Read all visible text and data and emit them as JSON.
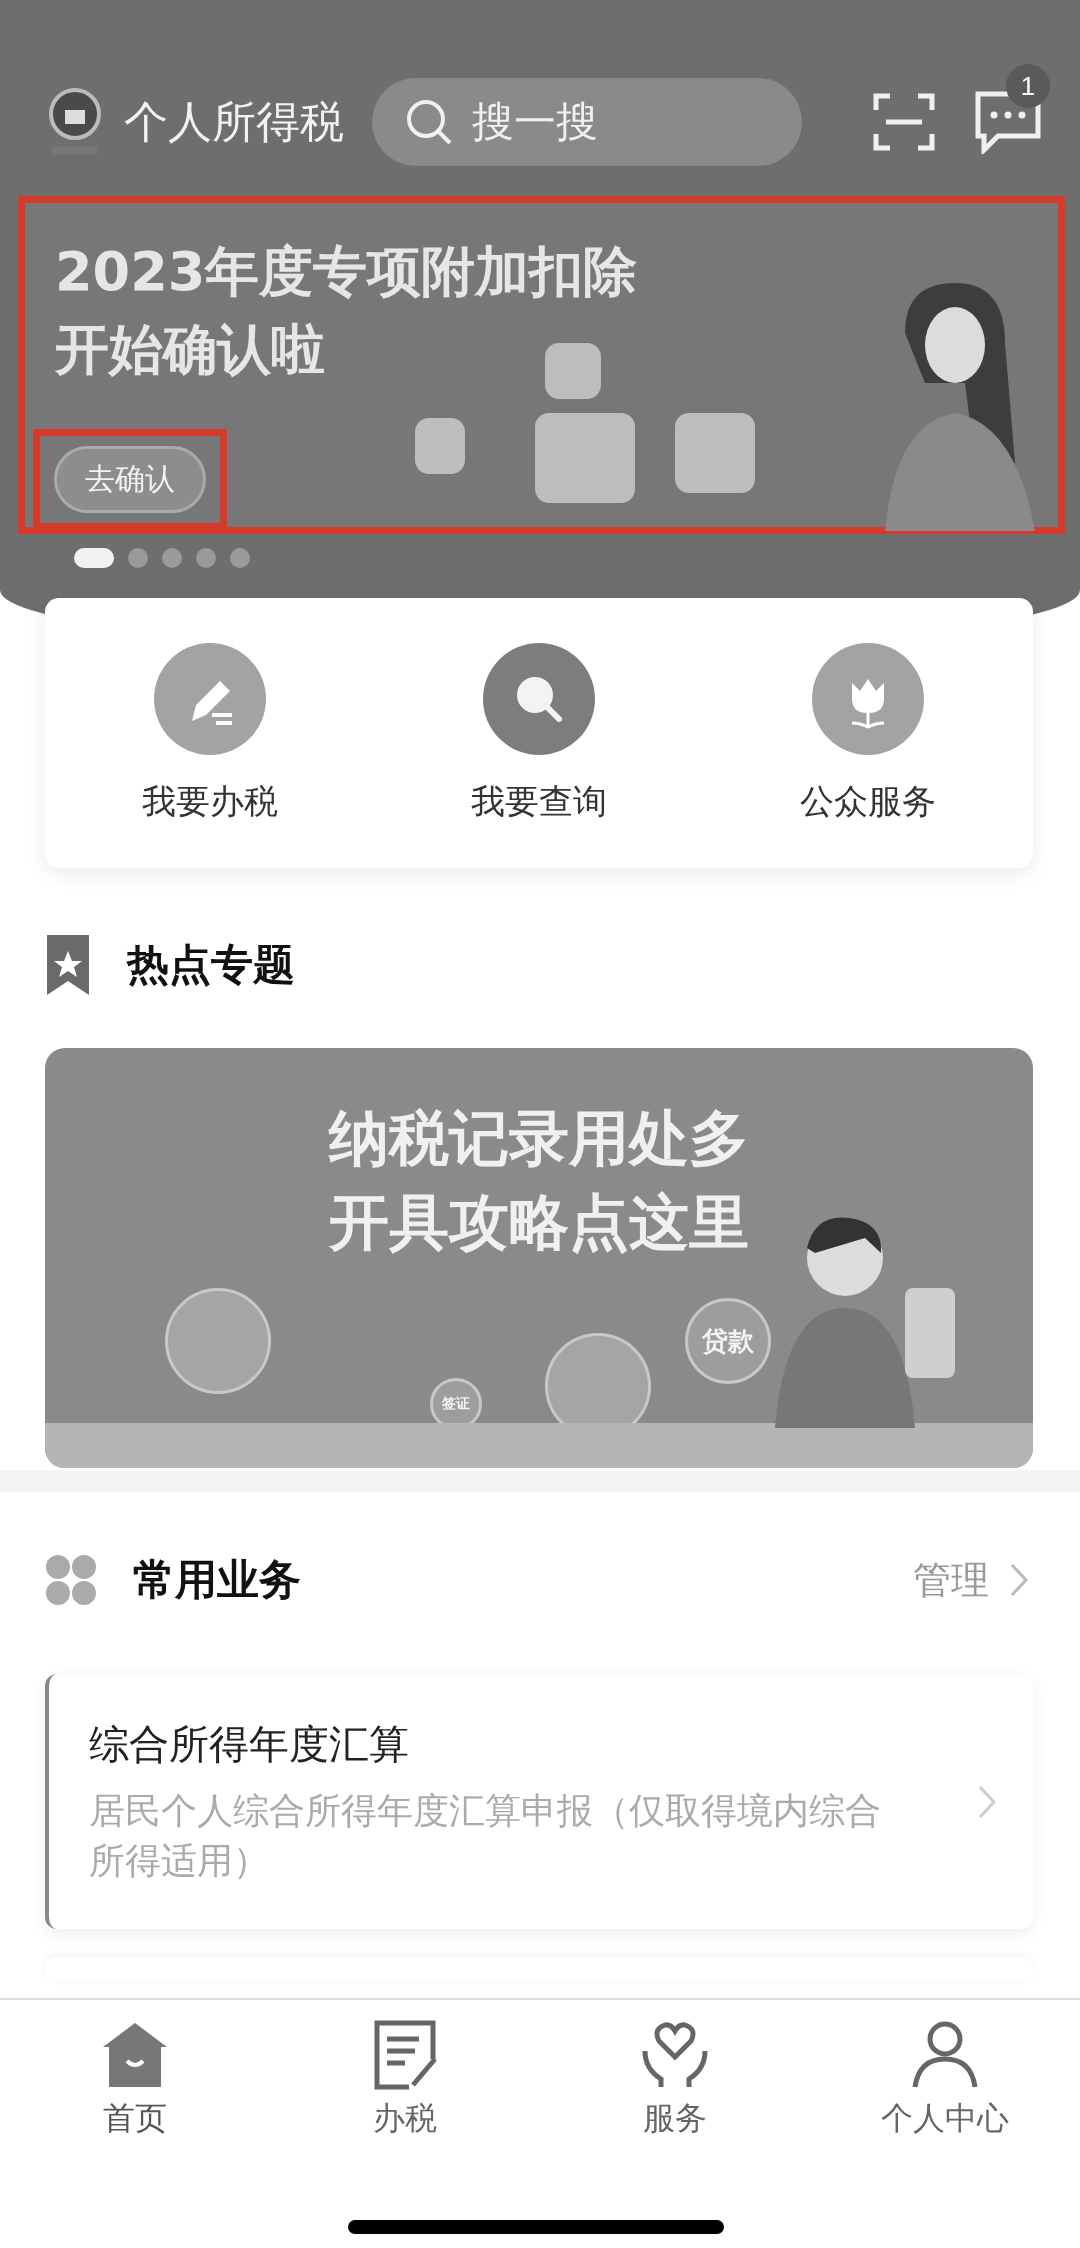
{
  "header": {
    "title": "个人所得税",
    "search": {
      "placeholder": "搜一搜"
    },
    "message_badge": "1"
  },
  "banner": {
    "lines": [
      "2023年度专项附加扣除",
      "开始确认啦"
    ],
    "highlighted": true,
    "button": {
      "label": "去确认",
      "highlighted": true
    },
    "dots": [
      {
        "selected": true
      },
      {
        "selected": false
      },
      {
        "selected": false
      },
      {
        "selected": false
      },
      {
        "selected": false
      }
    ]
  },
  "quick_actions": [
    {
      "label": "我要办税",
      "kind": "pen"
    },
    {
      "label": "我要查询",
      "kind": "search"
    },
    {
      "label": "公众服务",
      "kind": "flower"
    }
  ],
  "hot_topics": {
    "title": "热点专题",
    "banner": {
      "lines": [
        "纳税记录用处多",
        "开具攻略点这里"
      ],
      "bubbles": [
        "贷款",
        "签证"
      ]
    }
  },
  "common": {
    "title": "常用业务",
    "manage": "管理",
    "items": [
      {
        "title": "综合所得年度汇算",
        "description": "居民个人综合所得年度汇算申报（仅取得境内综合所得适用）"
      }
    ]
  },
  "tabs": [
    {
      "label": "首页",
      "kind": "home",
      "selected": true
    },
    {
      "label": "办税",
      "kind": "tax",
      "selected": false
    },
    {
      "label": "服务",
      "kind": "service",
      "selected": false
    },
    {
      "label": "个人中心",
      "kind": "person",
      "selected": false
    }
  ]
}
